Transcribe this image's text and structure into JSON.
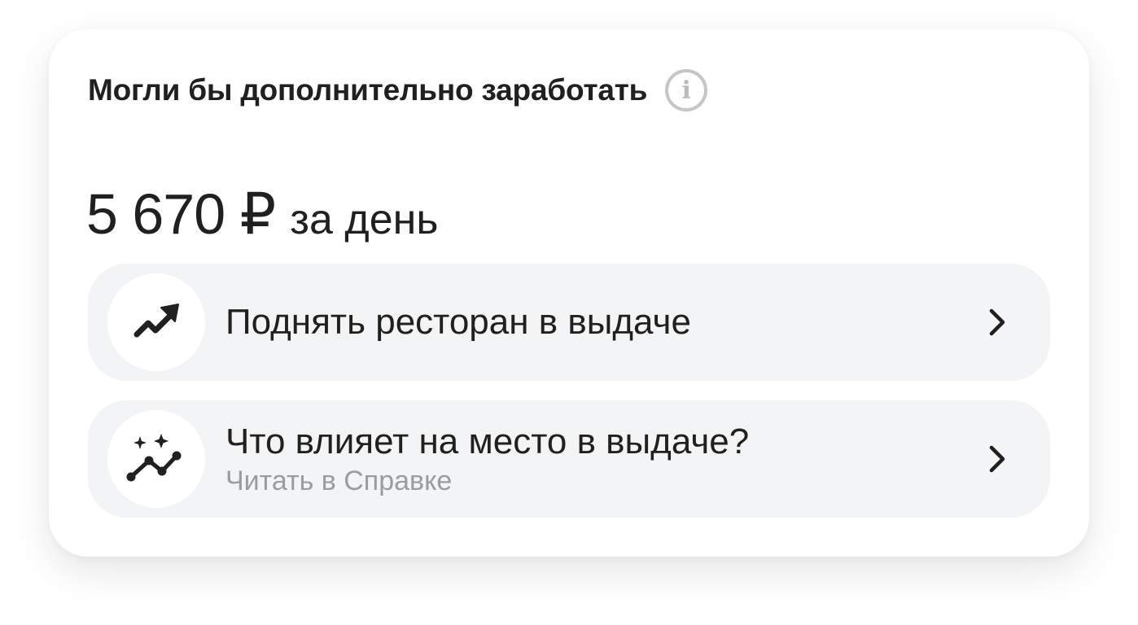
{
  "card": {
    "title": "Могли бы дополнительно заработать",
    "info_glyph": "i",
    "amount": "5 670 ₽",
    "period": "за день"
  },
  "actions": [
    {
      "title": "Поднять ресторан в выдаче",
      "icon": "trending-up-icon"
    },
    {
      "title": "Что влияет на место в выдаче?",
      "subtitle": "Читать в Справке",
      "icon": "sparkle-graph-icon"
    }
  ],
  "colors": {
    "text": "#21201f",
    "muted": "#9b9c9e",
    "row_bg": "#f3f4f6",
    "info_border": "#c4c6c9"
  }
}
